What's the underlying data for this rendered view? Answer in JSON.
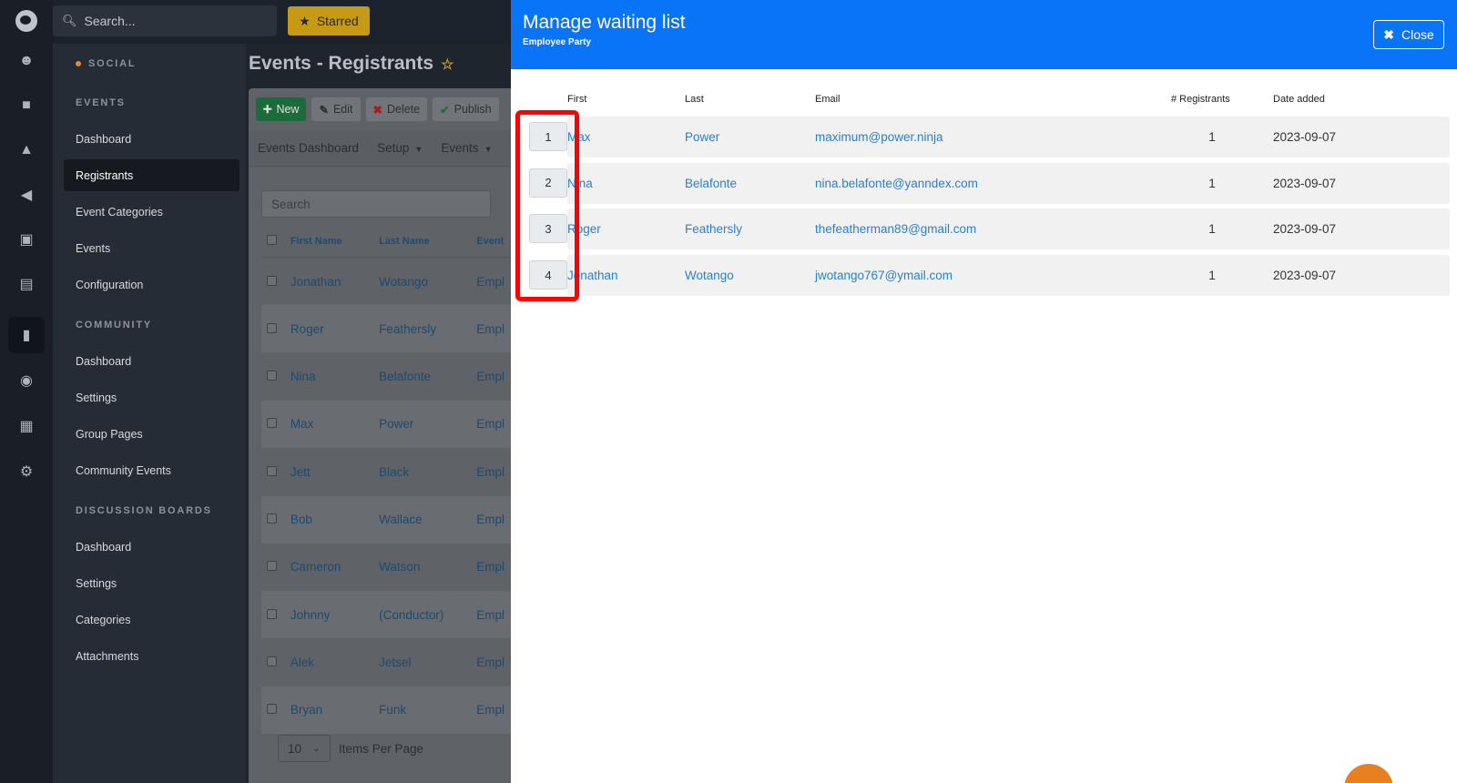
{
  "topbar": {
    "search_placeholder": "Search...",
    "starred_label": "Starred"
  },
  "sidebar": {
    "sections": [
      {
        "label": "SOCIAL"
      },
      {
        "label": "EVENTS"
      },
      {
        "label": "COMMUNITY"
      },
      {
        "label": "DISCUSSION BOARDS"
      }
    ],
    "events_items": [
      "Dashboard",
      "Registrants",
      "Event Categories",
      "Events",
      "Configuration"
    ],
    "community_items": [
      "Dashboard",
      "Settings",
      "Group Pages",
      "Community Events"
    ],
    "discussion_items": [
      "Dashboard",
      "Settings",
      "Categories",
      "Attachments"
    ]
  },
  "page": {
    "title": "Events - Registrants",
    "toolbar": {
      "new": "New",
      "edit": "Edit",
      "delete": "Delete",
      "publish": "Publish"
    },
    "tabs": [
      "Events Dashboard",
      "Setup",
      "Events"
    ],
    "search_placeholder": "Search",
    "columns": [
      "First Name",
      "Last Name",
      "Event"
    ],
    "rows": [
      {
        "first": "Jonathan",
        "last": "Wotango",
        "event": "Empl"
      },
      {
        "first": "Roger",
        "last": "Feathersly",
        "event": "Empl"
      },
      {
        "first": "Nina",
        "last": "Belafonte",
        "event": "Empl"
      },
      {
        "first": "Max",
        "last": "Power",
        "event": "Empl"
      },
      {
        "first": "Jett",
        "last": "Black",
        "event": "Empl"
      },
      {
        "first": "Bob",
        "last": "Wallace",
        "event": "Empl"
      },
      {
        "first": "Cameron",
        "last": "Watson",
        "event": "Empl"
      },
      {
        "first": "Johnny",
        "last": "(Conductor)",
        "event": "Empl"
      },
      {
        "first": "Alek",
        "last": "Jetsel",
        "event": "Empl"
      },
      {
        "first": "Bryan",
        "last": "Funk",
        "event": "Empl"
      }
    ],
    "per_page_value": "10",
    "per_page_label": "Items Per Page"
  },
  "drawer": {
    "title": "Manage waiting list",
    "subtitle": "Employee Party",
    "close_label": "Close",
    "columns": {
      "first": "First",
      "last": "Last",
      "email": "Email",
      "registrants": "# Registrants",
      "date": "Date added"
    },
    "rows": [
      {
        "order": "1",
        "first": "Max",
        "last": "Power",
        "email": "maximum@power.ninja",
        "registrants": "1",
        "date": "2023-09-07"
      },
      {
        "order": "2",
        "first": "Nina",
        "last": "Belafonte",
        "email": "nina.belafonte@yanndex.com",
        "registrants": "1",
        "date": "2023-09-07"
      },
      {
        "order": "3",
        "first": "Roger",
        "last": "Feathersly",
        "email": "thefeatherman89@gmail.com",
        "registrants": "1",
        "date": "2023-09-07"
      },
      {
        "order": "4",
        "first": "Jonathan",
        "last": "Wotango",
        "email": "jwotango767@ymail.com",
        "registrants": "1",
        "date": "2023-09-07"
      }
    ]
  },
  "colors": {
    "accent": "#0a74f8",
    "highlight": "#ff0000",
    "starred": "#c79a16",
    "link": "#2a7fcf"
  },
  "icons": [
    "logo-icon",
    "users-icon",
    "cubes-icon",
    "graduation-icon",
    "megaphone-icon",
    "ticket-icon",
    "chart-icon",
    "comment-icon",
    "palette-icon",
    "calendar-icon",
    "gear-icon",
    "search-icon",
    "star-icon",
    "close-icon",
    "chat-icon"
  ]
}
